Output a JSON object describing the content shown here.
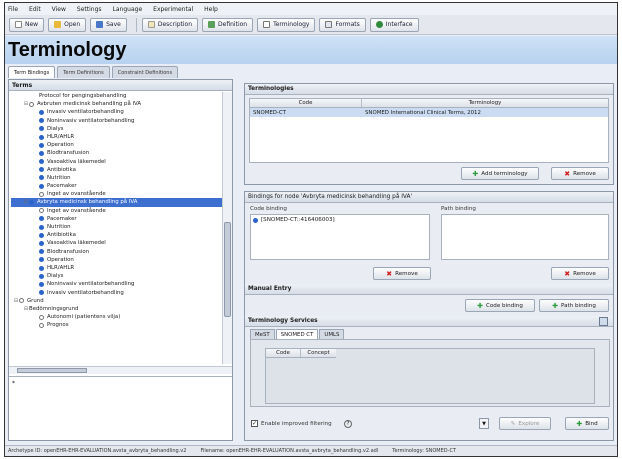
{
  "menu": [
    "File",
    "Edit",
    "View",
    "Settings",
    "Language",
    "Experimental",
    "Help"
  ],
  "toolbar": {
    "new": "New",
    "open": "Open",
    "save": "Save",
    "description": "Description",
    "definition": "Definition",
    "terminology": "Terminology",
    "formats": "Formats",
    "interface": "Interface"
  },
  "page_title": "Terminology",
  "tabs": [
    "Term Bindings",
    "Term Definitions",
    "Constraint Definitions"
  ],
  "terms_panel": {
    "title": "Terms"
  },
  "tree": [
    {
      "indent": 2,
      "exp": "",
      "icon": "none",
      "label": "Protocol for pengingsbehandling",
      "sel": false
    },
    {
      "indent": 1,
      "exp": "⊟",
      "icon": "open",
      "label": "Avbruten medicinsk behandling på IVA",
      "sel": false
    },
    {
      "indent": 2,
      "exp": "",
      "icon": "blue",
      "label": "Invasiv ventilatorbehandling",
      "sel": false
    },
    {
      "indent": 2,
      "exp": "",
      "icon": "blue",
      "label": "Noninvasiv ventilatorbehandling",
      "sel": false
    },
    {
      "indent": 2,
      "exp": "",
      "icon": "blue",
      "label": "Dialys",
      "sel": false
    },
    {
      "indent": 2,
      "exp": "",
      "icon": "blue",
      "label": "HLR/AHLR",
      "sel": false
    },
    {
      "indent": 2,
      "exp": "",
      "icon": "blue",
      "label": "Operation",
      "sel": false
    },
    {
      "indent": 2,
      "exp": "",
      "icon": "blue",
      "label": "Blodtransfusion",
      "sel": false
    },
    {
      "indent": 2,
      "exp": "",
      "icon": "blue",
      "label": "Vasoaktiva läkemedel",
      "sel": false
    },
    {
      "indent": 2,
      "exp": "",
      "icon": "blue",
      "label": "Antibiotika",
      "sel": false
    },
    {
      "indent": 2,
      "exp": "",
      "icon": "blue",
      "label": "Nutrition",
      "sel": false
    },
    {
      "indent": 2,
      "exp": "",
      "icon": "blue",
      "label": "Pacemaker",
      "sel": false
    },
    {
      "indent": 2,
      "exp": "",
      "icon": "open",
      "label": "Inget av ovanstående",
      "sel": false
    },
    {
      "indent": 1,
      "exp": "⊟",
      "icon": "blue",
      "label": "Avbryta medicinsk behandling på IVA",
      "sel": true
    },
    {
      "indent": 2,
      "exp": "",
      "icon": "open",
      "label": "Inget av ovanstående",
      "sel": false
    },
    {
      "indent": 2,
      "exp": "",
      "icon": "blue",
      "label": "Pacemaker",
      "sel": false
    },
    {
      "indent": 2,
      "exp": "",
      "icon": "blue",
      "label": "Nutrition",
      "sel": false
    },
    {
      "indent": 2,
      "exp": "",
      "icon": "blue",
      "label": "Antibiotika",
      "sel": false
    },
    {
      "indent": 2,
      "exp": "",
      "icon": "blue",
      "label": "Vasoaktiva läkemedel",
      "sel": false
    },
    {
      "indent": 2,
      "exp": "",
      "icon": "blue",
      "label": "Blodtransfusion",
      "sel": false
    },
    {
      "indent": 2,
      "exp": "",
      "icon": "blue",
      "label": "Operation",
      "sel": false
    },
    {
      "indent": 2,
      "exp": "",
      "icon": "blue",
      "label": "HLR/AHLR",
      "sel": false
    },
    {
      "indent": 2,
      "exp": "",
      "icon": "blue",
      "label": "Dialys",
      "sel": false
    },
    {
      "indent": 2,
      "exp": "",
      "icon": "blue",
      "label": "Noninvasiv ventilatorbehandling",
      "sel": false
    },
    {
      "indent": 2,
      "exp": "",
      "icon": "blue",
      "label": "Invasiv ventilatorbehandling",
      "sel": false
    },
    {
      "indent": 0,
      "exp": "⊟",
      "icon": "open",
      "label": "Grund",
      "sel": false
    },
    {
      "indent": 1,
      "exp": "⊟",
      "icon": "none",
      "label": "Bedömningsgrund",
      "sel": false
    },
    {
      "indent": 2,
      "exp": "",
      "icon": "open",
      "label": "Autonomi (patientens vilja)",
      "sel": false
    },
    {
      "indent": 2,
      "exp": "",
      "icon": "open",
      "label": "Prognos",
      "sel": false
    }
  ],
  "desc_box": "*",
  "terminologies": {
    "title": "Terminologies",
    "col_code": "Code",
    "col_terminology": "Terminology",
    "rows": [
      {
        "code": "SNOMED-CT",
        "terminology": "SNOMED International Clinical Terms, 2012"
      }
    ],
    "add_label": "Add terminology",
    "remove_label": "Remove"
  },
  "bindings": {
    "title": "Bindings for node 'Avbryta medicinsk behandling på IVA'",
    "code_binding_label": "Code binding",
    "path_binding_label": "Path binding",
    "code_items": [
      "[SNOMED-CT::416406003]"
    ],
    "remove_label": "Remove",
    "remove_label2": "Remove"
  },
  "manual_entry": {
    "title": "Manual Entry",
    "code_binding_btn": "Code binding",
    "path_binding_btn": "Path binding"
  },
  "terminology_services": {
    "title": "Terminology Services",
    "tabs": [
      "MeST",
      "SNOMED CT",
      "UMLS"
    ],
    "col_code": "Code",
    "col_concept": "Concept",
    "checkbox_label": "Enable improved filtering",
    "explore_label": "Explore",
    "bind_label": "Bind"
  },
  "status": {
    "archetype": "Archetype ID: openEHR-EHR-EVALUATION.avsta_avbryta_behandling.v2",
    "filename": "Filename: openEHR-EHR-EVALUATION.avsta_avbryta_behandling.v2.adl",
    "terminology": "Terminology: SNOMED-CT"
  },
  "colors": {
    "title_bg": "#b7d1ef",
    "selection": "#3c6fd0",
    "remove": "#d12020",
    "add": "#2b9a3a"
  }
}
